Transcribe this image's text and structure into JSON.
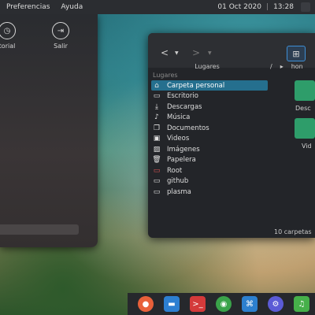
{
  "topbar": {
    "menus": [
      "Preferencias",
      "Ayuda"
    ],
    "date": "01 Oct 2020",
    "separator": "|",
    "time": "13:28"
  },
  "launcher": {
    "buttons": [
      {
        "label": "torial",
        "icon": "clock-icon"
      },
      {
        "label": "Salir",
        "icon": "exit-icon"
      }
    ]
  },
  "filemanager": {
    "sidebar_title": "Lugares",
    "sidebar_caption": "Lugares",
    "path": [
      "/",
      "▸",
      "hon"
    ],
    "places": [
      {
        "label": "Carpeta personal",
        "icon": "home-icon",
        "selected": true
      },
      {
        "label": "Escritorio",
        "icon": "desktop-icon"
      },
      {
        "label": "Descargas",
        "icon": "download-icon"
      },
      {
        "label": "Música",
        "icon": "music-icon"
      },
      {
        "label": "Documentos",
        "icon": "documents-icon"
      },
      {
        "label": "Videos",
        "icon": "video-icon"
      },
      {
        "label": "Imágenes",
        "icon": "image-icon"
      },
      {
        "label": "Papelera",
        "icon": "trash-icon"
      },
      {
        "label": "Root",
        "icon": "root-folder-icon"
      },
      {
        "label": "github",
        "icon": "folder-icon"
      },
      {
        "label": "plasma",
        "icon": "folder-icon"
      }
    ],
    "files": [
      {
        "label": "Desc"
      },
      {
        "label": "Vid"
      }
    ],
    "status": "10 carpetas",
    "accent": "#256f8e"
  },
  "dock": {
    "apps": [
      {
        "name": "firefox-icon",
        "color": "#e8603a"
      },
      {
        "name": "files-icon",
        "color": "#2d7fd1"
      },
      {
        "name": "terminal-icon",
        "color": "#d43a3a"
      },
      {
        "name": "chrome-icon",
        "color": "#3aa34a"
      },
      {
        "name": "vscode-icon",
        "color": "#2d80cf"
      },
      {
        "name": "settings-icon",
        "color": "#5b5bd6"
      },
      {
        "name": "music-app-icon",
        "color": "#46b04a"
      }
    ]
  }
}
